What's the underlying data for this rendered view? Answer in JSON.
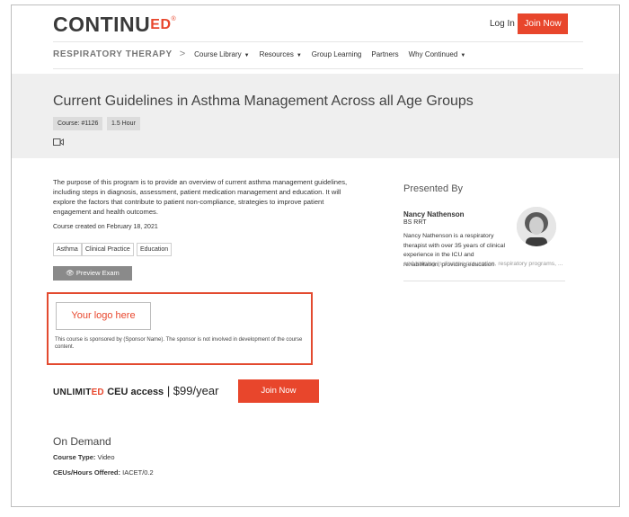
{
  "header": {
    "logo_main": "CONTINU",
    "logo_ed": "ED",
    "logo_reg": "®",
    "login_label": "Log In",
    "join_label": "Join Now"
  },
  "nav": {
    "brand": "RESPIRATORY THERAPY",
    "separator": ">",
    "items": [
      {
        "label": "Course Library",
        "has_dropdown": true
      },
      {
        "label": "Resources",
        "has_dropdown": true
      },
      {
        "label": "Group Learning",
        "has_dropdown": false
      },
      {
        "label": "Partners",
        "has_dropdown": false
      },
      {
        "label": "Why Continued",
        "has_dropdown": true
      }
    ]
  },
  "course": {
    "title": "Current Guidelines in Asthma Management Across all Age Groups",
    "course_number": "Course: #1126",
    "duration": "1.5 Hour",
    "media_icon": "video-camera-icon",
    "description": "The purpose of this program is to provide an overview of current asthma management guidelines, including steps in diagnosis, assessment, patient medication management and education. It will explore the factors that contribute to patient non-compliance, strategies to improve patient engagement and health outcomes.",
    "created": "Course created on February 18, 2021",
    "tags": [
      "Asthma",
      "Clinical Practice",
      "Education"
    ],
    "preview_label": "Preview Exam"
  },
  "sponsor": {
    "logo_placeholder": "Your logo here",
    "text": "This course is sponsored by (Sponsor Name). The sponsor is not involved in development of the course content."
  },
  "membership": {
    "unlimited_prefix": "UNLIMIT",
    "unlimited_ed": "ED",
    "ceu_access": "CEU access",
    "price": "| $99/year",
    "join_label": "Join Now"
  },
  "on_demand": {
    "heading": "On Demand",
    "course_type_label": "Course Type:",
    "course_type_value": "Video",
    "ceus_label": "CEUs/Hours Offered:",
    "ceus_value": "IACET/0.2"
  },
  "presenter": {
    "heading": "Presented By",
    "name": "Nancy Nathenson",
    "credentials": "BS RRT",
    "bio": "Nancy Nathenson is a respiratory therapist with over 35 years of clinical experience in the ICU and rehabilitation, providing education",
    "bio_faded": "and training in disease prevention, respiratory programs, ..."
  },
  "colors": {
    "accent": "#e8462c",
    "hero_bg": "#efefef",
    "preview_button": "#8a8a8a"
  }
}
